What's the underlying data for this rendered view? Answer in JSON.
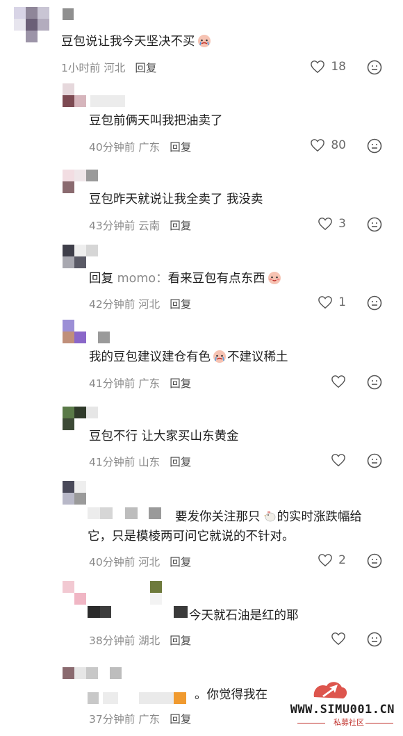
{
  "comments": [
    {
      "text": "豆包说让我今天坚决不买",
      "time": "1小时前",
      "location": "河北",
      "reply": "回复",
      "likes": "18"
    },
    {
      "text": "豆包前俩天叫我把油卖了",
      "time": "40分钟前",
      "location": "广东",
      "reply": "回复",
      "likes": "80"
    },
    {
      "text": "豆包昨天就说让我全卖了 我没卖",
      "time": "43分钟前",
      "location": "云南",
      "reply": "回复",
      "likes": "3"
    },
    {
      "prefix": "回复",
      "mention": "momo：",
      "text": "看来豆包有点东西",
      "time": "42分钟前",
      "location": "河北",
      "reply": "回复",
      "likes": "1"
    },
    {
      "text_before": "我的豆包建议建仓有色",
      "text_after": "不建议稀土",
      "time": "41分钟前",
      "location": "广东",
      "reply": "回复",
      "likes": ""
    },
    {
      "text": "豆包不行 让大家买山东黄金",
      "time": "41分钟前",
      "location": "山东",
      "reply": "回复",
      "likes": ""
    },
    {
      "text_line1_before": "要发你关注那只",
      "text_line1_after": "的实时涨跌幅给",
      "text_line2": "它，只是模棱两可问它就说的不针对。",
      "time": "40分钟前",
      "location": "河北",
      "reply": "回复",
      "likes": "2"
    },
    {
      "text": "今天就石油是红的耶",
      "time": "38分钟前",
      "location": "湖北",
      "reply": "回复",
      "likes": ""
    },
    {
      "text": "。你觉得我在",
      "time": "37分钟前",
      "location": "广东",
      "reply": "回复",
      "likes": ""
    }
  ],
  "watermark": {
    "site": "WWW.SIMU001.CN",
    "sub": "私募社区"
  },
  "colors": {
    "text": "#1f1f1f",
    "meta": "#8a8a8a",
    "brand": "#c0302b"
  }
}
